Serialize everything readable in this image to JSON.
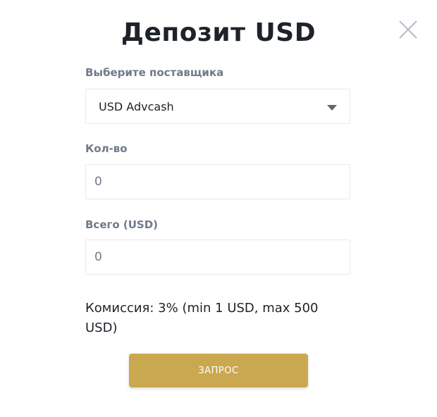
{
  "dialog": {
    "title": "Депозит USD"
  },
  "provider": {
    "label": "Выберите поставщика",
    "selected": "USD Advcash"
  },
  "amount": {
    "label": "Кол-во",
    "placeholder": "0"
  },
  "total": {
    "label": "Всего (USD)",
    "placeholder": "0"
  },
  "fee_text": "Комиссия: 3% (min 1 USD, max 500 USD)",
  "submit_label": "ЗАПРОС",
  "icons": {
    "close": "close-icon",
    "dropdown": "chevron-down-icon"
  },
  "colors": {
    "accent": "#c9a850",
    "title": "#1e2329",
    "label": "#707a8a"
  }
}
